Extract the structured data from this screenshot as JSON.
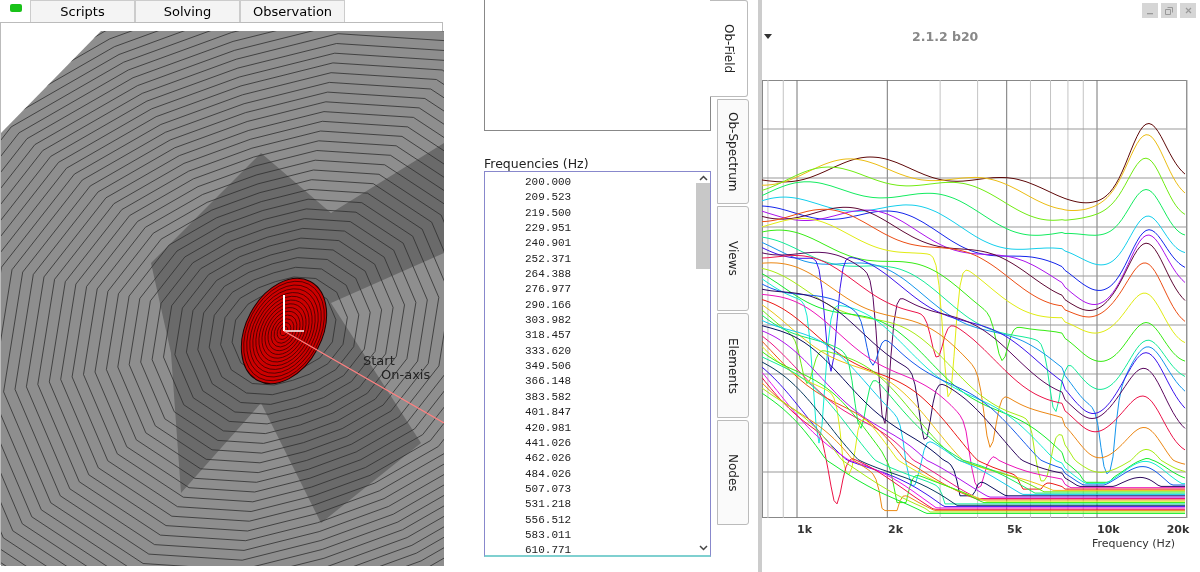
{
  "top_tabs": [
    {
      "label": "Scripts",
      "selected": false
    },
    {
      "label": "Solving",
      "selected": false
    },
    {
      "label": "Observation",
      "selected": false
    }
  ],
  "view_3d": {
    "labels": [
      "Start",
      "On-axis"
    ]
  },
  "frequencies": {
    "title": "Frequencies  (Hz)",
    "items": [
      "200.000",
      "209.523",
      "219.500",
      "229.951",
      "240.901",
      "252.371",
      "264.388",
      "276.977",
      "290.166",
      "303.982",
      "318.457",
      "333.620",
      "349.506",
      "366.148",
      "383.582",
      "401.847",
      "420.981",
      "441.026",
      "462.026",
      "484.026",
      "507.073",
      "531.218",
      "556.512",
      "583.011",
      "610.771"
    ]
  },
  "side_tabs": [
    {
      "label": "Ob-Field",
      "selected": true
    },
    {
      "label": "Ob-Spectrum",
      "selected": false
    },
    {
      "label": "Views",
      "selected": false
    },
    {
      "label": "Elements",
      "selected": false
    },
    {
      "label": "Nodes",
      "selected": false
    }
  ],
  "version": "2.1.2 b20",
  "plot": {
    "x_tick_labels": [
      "1k",
      "2k",
      "5k",
      "10k",
      "20k"
    ],
    "x_axis_label": "Frequency  (Hz)"
  }
}
